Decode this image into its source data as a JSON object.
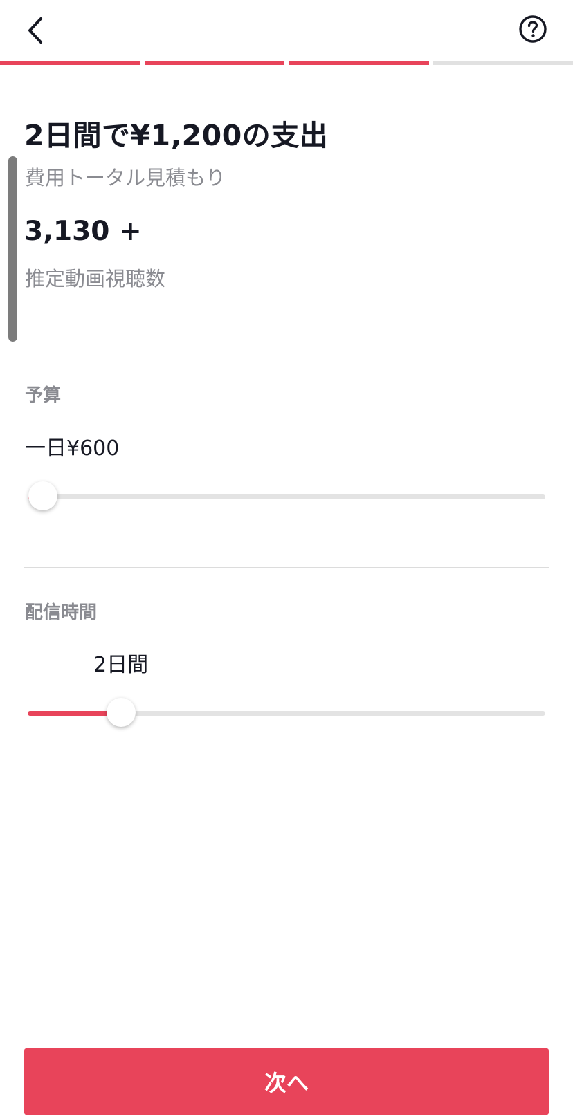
{
  "colors": {
    "accent": "#e8445a",
    "progress_inactive": "#e1e1e1",
    "text_primary": "#161823",
    "text_secondary": "#8a8b91"
  },
  "header": {
    "back_icon": "chevron-left-icon",
    "help_icon": "question-circle-icon"
  },
  "progress": {
    "total_steps": 4,
    "completed_steps": 3
  },
  "summary": {
    "title": "2日間で¥1,200の支出",
    "subtitle": "費用トータル見積もり",
    "views_value": "3,130 +",
    "views_label": "推定動画視聴数"
  },
  "budget": {
    "label": "予算",
    "value_text": "一日¥600",
    "slider_fraction": 0.03
  },
  "duration": {
    "label": "配信時間",
    "value_text": "2日間",
    "slider_fraction": 0.18
  },
  "footer": {
    "next_label": "次へ"
  }
}
